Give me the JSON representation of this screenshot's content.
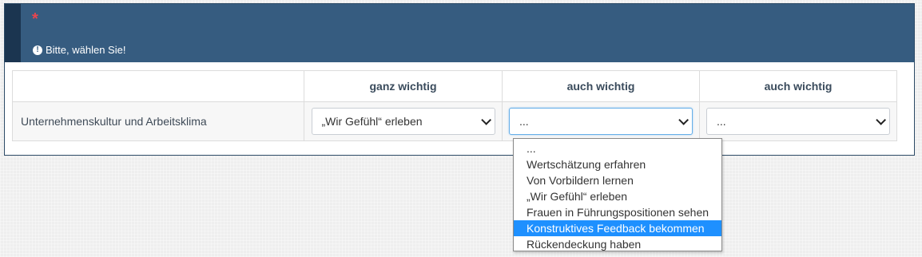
{
  "question": {
    "required_marker": "*",
    "tip_icon": "exclamation-circle-icon",
    "tip": "Bitte, wählen Sie!"
  },
  "table": {
    "headers": [
      "",
      "ganz wichtig",
      "auch wichtig",
      "auch wichtig"
    ],
    "rows": [
      {
        "label": "Unternehmenskultur und Arbeitsklima",
        "selects": [
          "„Wir Gefühl“ erleben",
          "...",
          "..."
        ]
      }
    ]
  },
  "dropdown": {
    "options": [
      "...",
      "Wertschätzung erfahren",
      "Von Vorbildern lernen",
      "„Wir Gefühl“ erleben",
      "Frauen in Führungspositionen sehen",
      "Konstruktives Feedback bekommen",
      "Rückendeckung haben"
    ],
    "highlighted_index": 5
  },
  "colors": {
    "header_bg": "#365c80",
    "header_bar": "#1b3550",
    "required": "#e8454e",
    "highlight": "#1e90ff"
  }
}
